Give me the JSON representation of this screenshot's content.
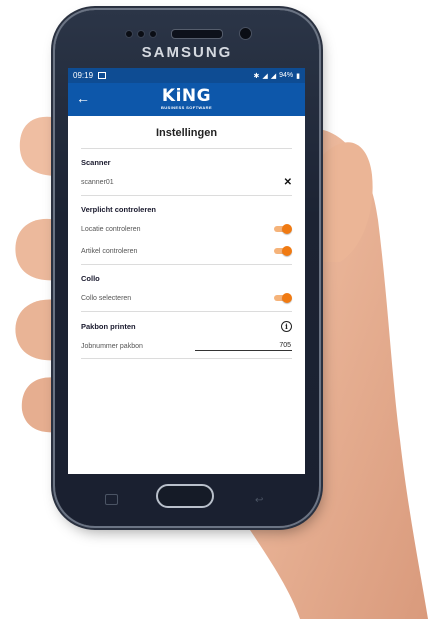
{
  "device": {
    "brand": "SAMSUNG"
  },
  "status_bar": {
    "time": "09:19",
    "battery": "94%"
  },
  "app_bar": {
    "back_icon": "arrow-left-icon",
    "logo_main": "KiNG",
    "logo_sub": "BUSINESS SOFTWARE"
  },
  "page": {
    "title": "Instellingen"
  },
  "scanner": {
    "header": "Scanner",
    "value": "scanner01",
    "clear_icon": "close-icon"
  },
  "verplicht": {
    "header": "Verplicht controleren",
    "locatie_label": "Locatie controleren",
    "locatie_on": true,
    "artikel_label": "Artikel controleren",
    "artikel_on": true
  },
  "collo": {
    "header": "Collo",
    "selecteren_label": "Collo selecteren",
    "selecteren_on": true
  },
  "pakbon": {
    "header": "Pakbon printen",
    "info_icon": "info-icon",
    "job_label": "Jobnummer pakbon",
    "job_value": "705"
  },
  "colors": {
    "header_blue": "#0d57aa",
    "toggle_orange": "#f07a12"
  }
}
